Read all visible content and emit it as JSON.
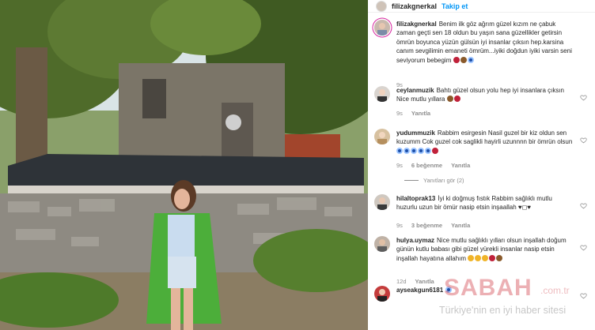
{
  "header": {
    "username": "filizakgnerkal",
    "follow_label": "Takip et"
  },
  "caption": {
    "username": "filizakgnerkal",
    "text": "Benim ilk göz ağrım güzel kızım ne çabuk zaman geçti sen 18 oldun bu yaşın sana güzellikler getirsin ömrün boyunca yüzün gülsün iyi insanlar çıksın hep.karsina canım sevgilimin emaneti ömrüm...iyiki doğdun iyiki varsin seni seviyorum bebegim",
    "time": "9s"
  },
  "comments": [
    {
      "username": "ceylanmuzik",
      "text_line1": "Bahtı güzel olsun yolu hep iyi insanlara çıksın",
      "text_line2": "Nice mutlu yıllara",
      "time": "9s",
      "reply_label": "Yanıtla"
    },
    {
      "username": "yudummuzik",
      "text": "Rabbim esirgesin Nasil guzel bir kiz oldun sen kuzumm Cok guzel cok saglikli hayirli uzunnnn bir ömrün olsun",
      "time": "9s",
      "likes": "6 beğenme",
      "reply_label": "Yanıtla",
      "view_replies": "Yanıtları gör (2)"
    },
    {
      "username": "hilaltoprak13",
      "text": "İyi ki doğmuş fıstık Rabbim sağlıklı mutlu huzurlu uzun bir ömür nasip etsin inşaallah",
      "time": "9s",
      "likes": "3 beğenme",
      "reply_label": "Yanıtla"
    },
    {
      "username": "hulya.uymaz",
      "text": "Nice mutlu sağlıklı yılları olsun inşallah doğum günün kutlu babası gibi güzel yürekli insanlar nasip etsin inşallah hayatına allahım",
      "time": "12d",
      "reply_label": "Yanıtla"
    },
    {
      "username": "ayseakgun6181",
      "text": ""
    }
  ],
  "watermark": {
    "brand": "SABAH",
    "domain": ".com.tr",
    "tagline": "Türkiye'nin en iyi haber sitesi"
  },
  "colors": {
    "link": "#0095f6",
    "text": "#262626",
    "muted": "#8e8e8e"
  },
  "icons": [
    "heart-icon",
    "smile-emoji",
    "heart-emoji",
    "blue-circle-emoji"
  ]
}
